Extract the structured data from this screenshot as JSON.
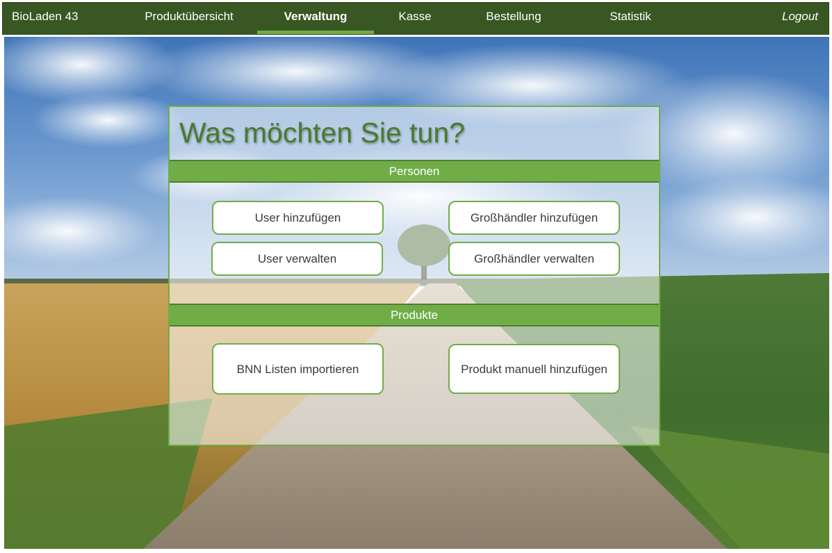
{
  "nav": {
    "brand": "BioLaden 43",
    "items": [
      {
        "label": "Produktübersicht"
      },
      {
        "label": "Verwaltung",
        "active": true
      },
      {
        "label": "Kasse"
      },
      {
        "label": "Bestellung"
      },
      {
        "label": "Statistik"
      }
    ],
    "logout": "Logout"
  },
  "panel": {
    "title": "Was möchten Sie tun?",
    "sections": [
      {
        "title": "Personen",
        "buttons": [
          "User hinzufügen",
          "Großhändler hinzufügen",
          "User verwalten",
          "Großhändler verwalten"
        ]
      },
      {
        "title": "Produkte",
        "buttons": [
          "BNN Listen importieren",
          "Produkt manuell hinzufügen"
        ]
      }
    ]
  },
  "colors": {
    "nav_background": "#385723",
    "accent": "#70ad47",
    "title_text": "#4b7a2c",
    "button_background": "#ffffff"
  }
}
